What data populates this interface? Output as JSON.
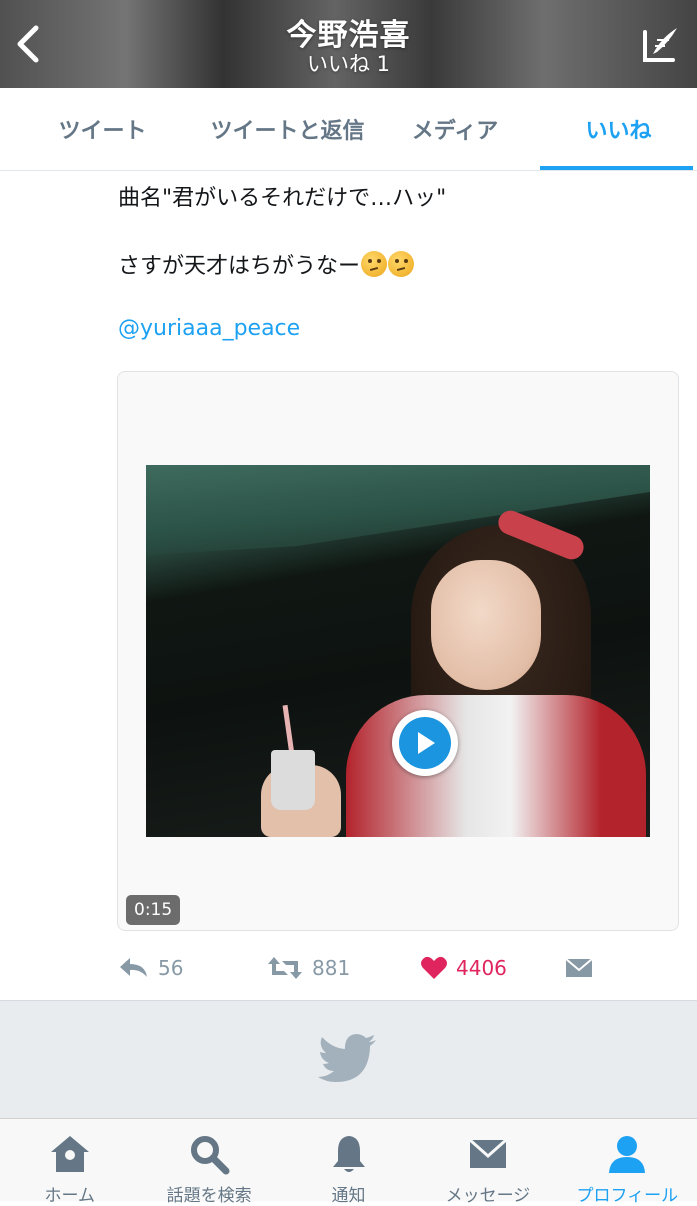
{
  "header": {
    "title": "今野浩喜",
    "subtitle": "いいね 1"
  },
  "tabs": [
    {
      "label": "ツイート",
      "active": false
    },
    {
      "label": "ツイートと返信",
      "active": false
    },
    {
      "label": "メディア",
      "active": false
    },
    {
      "label": "いいね",
      "active": true
    }
  ],
  "tweet": {
    "line1": "曲名\"君がいるそれだけで…ハッ\"",
    "line2": "さすが天才はちがうなー",
    "line2_emojis": [
      "thinking-face-emoji",
      "thinking-face-emoji"
    ],
    "mention": "@yuriaaa_peace",
    "video": {
      "duration": "0:15",
      "icon": "play-icon"
    },
    "actions": {
      "reply_count": "56",
      "retweet_count": "881",
      "like_count": "4406"
    }
  },
  "tabbar": [
    {
      "label": "ホーム",
      "icon": "home-icon",
      "active": false
    },
    {
      "label": "話題を検索",
      "icon": "search-icon",
      "active": false
    },
    {
      "label": "通知",
      "icon": "bell-icon",
      "active": false
    },
    {
      "label": "メッセージ",
      "icon": "envelope-icon",
      "active": false
    },
    {
      "label": "プロフィール",
      "icon": "person-icon",
      "active": true
    }
  ],
  "colors": {
    "accent": "#1da1f2",
    "like": "#e0245e",
    "muted": "#8899a6"
  }
}
